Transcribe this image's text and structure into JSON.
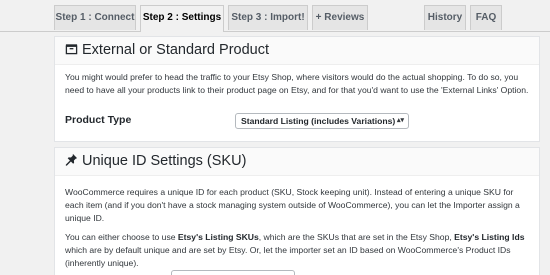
{
  "tabs": [
    {
      "label": "Step 1 : Connect",
      "active": false
    },
    {
      "label": "Step 2 : Settings",
      "active": true
    },
    {
      "label": "Step 3 : Import!",
      "active": false
    },
    {
      "label": "+ Reviews",
      "active": false
    },
    {
      "label": "History",
      "active": false
    },
    {
      "label": "FAQ",
      "active": false
    }
  ],
  "external_section": {
    "icon": "box-icon",
    "title": "External or Standard Product",
    "description": "You might would prefer to head the traffic to your Etsy Shop, where visitors would do the actual shopping. To do so, you need to have all your products link to their product page on Etsy, and for that you'd want to use the 'External Links' Option.",
    "product_type_label": "Product Type",
    "product_type_value": "Standard Listing (includes Variations)"
  },
  "sku_section": {
    "icon": "pushpin-icon",
    "title": "Unique ID Settings (SKU)",
    "description_1": "WooCommerce requires a unique ID for each product (SKU, Stock keeping unit). Instead of entering a unique SKU for each item (and if you don't have a stock managing system outside of WooCommerce), you can let the Importer assign a unique ID.",
    "description_2_pre": "You can either choose to use ",
    "description_2_bold1": "Etsy's Listing SKUs",
    "description_2_mid": ", which are the SKUs that are set in the Etsy Shop, ",
    "description_2_bold2": "Etsy's Listing Ids",
    "description_2_post": " which are by default unique and are set by Etsy. Or, let the importer set an ID based on WooCommerce's Product IDs (inherently unique)."
  },
  "colors": {
    "background": "#f1f1f1",
    "card": "#ffffff",
    "tab_inactive": "#e5e5e5",
    "border": "#cccccc"
  }
}
